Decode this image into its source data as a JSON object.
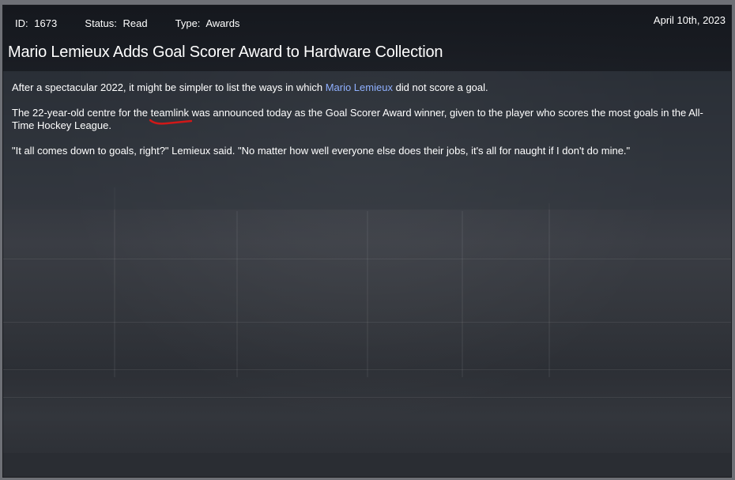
{
  "meta": {
    "id_label": "ID:",
    "id_value": "1673",
    "status_label": "Status:",
    "status_value": "Read",
    "type_label": "Type:",
    "type_value": "Awards"
  },
  "date": "April 10th, 2023",
  "headline": "Mario Lemieux Adds Goal Scorer Award to Hardware Collection",
  "paragraphs": {
    "p1_before": "After a spectacular 2022, it might be simpler to list the ways in which ",
    "p1_link": "Mario Lemieux",
    "p1_after": " did not score a goal.",
    "p2_before": "The 22-year-old centre for the ",
    "p2_link": "teamlink",
    "p2_after": " was announced today as the Goal Scorer Award winner, given to the player who scores the most goals in the All-Time Hockey League.",
    "p3": "\"It all comes down to goals, right?\" Lemieux said. \"No matter how well everyone else does their jobs, it's all for naught if I don't do mine.\""
  },
  "colors": {
    "link": "#8fb0ff",
    "annotation": "#d01818"
  }
}
